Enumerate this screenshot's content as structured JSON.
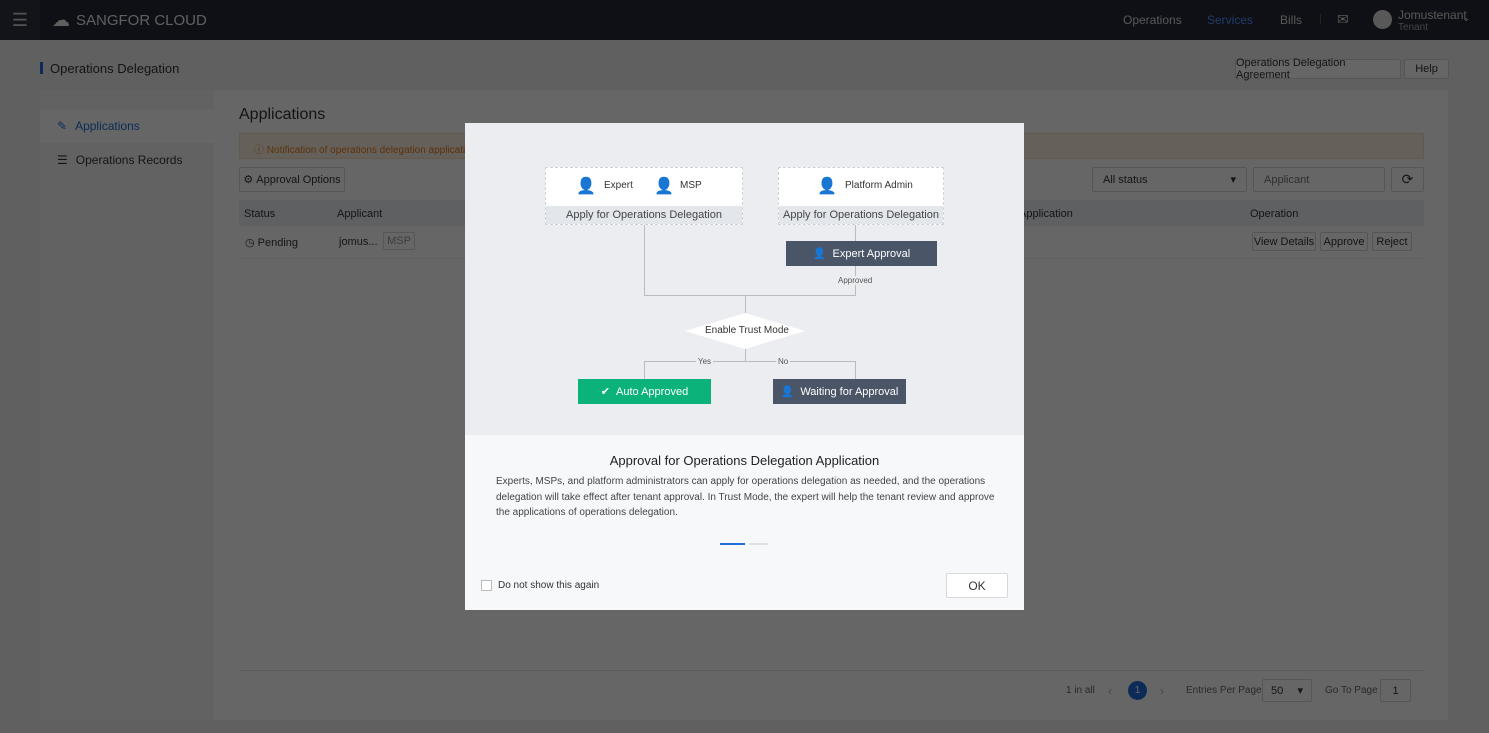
{
  "header": {
    "logo": "SANGFOR CLOUD",
    "nav": [
      "Operations",
      "Services",
      "Bills"
    ],
    "active_nav": "Services",
    "user": "Jomustenant",
    "role": "Tenant"
  },
  "page": {
    "title": "Operations Delegation",
    "agreement_btn": "Operations Delegation Agreement",
    "help_btn": "Help"
  },
  "sidebar": {
    "items": [
      {
        "label": "Applications",
        "active": true
      },
      {
        "label": "Operations Records"
      }
    ]
  },
  "main": {
    "title": "Applications",
    "notice": "Notification of operations delegation applications",
    "approval_options": "Approval Options",
    "status_filter": "All status",
    "search_placeholder": "Applicant",
    "columns": [
      "Status",
      "Applicant",
      "Application",
      "Operation"
    ],
    "rows": [
      {
        "status": "Pending",
        "applicant": "jomus...",
        "tag": "MSP",
        "actions": [
          "View Details",
          "Approve",
          "Reject"
        ]
      }
    ],
    "pagination": {
      "total": "1 in all",
      "page": "1",
      "entries_label": "Entries Per Page",
      "entries": "50",
      "goto_label": "Go To Page",
      "goto": "1"
    }
  },
  "modal": {
    "diagram": {
      "expert": "Expert",
      "msp": "MSP",
      "platform_admin": "Platform Admin",
      "apply": "Apply for Operations Delegation",
      "expert_approval": "Expert Approval",
      "approved": "Approved",
      "trust_mode": "Enable Trust Mode",
      "yes": "Yes",
      "no": "No",
      "auto_approved": "Auto Approved",
      "waiting": "Waiting for Approval"
    },
    "title": "Approval for Operations Delegation Application",
    "description": "Experts, MSPs, and platform administrators can apply for operations delegation as needed, and the operations delegation will take effect after tenant approval. In Trust Mode, the expert will help the tenant review and approve the applications of operations delegation.",
    "carousel": {
      "current": 1,
      "total": 2
    },
    "dont_show": "Do not show this again",
    "ok": "OK"
  },
  "colors": {
    "accent": "#1e6fd9",
    "green": "#0bb27a",
    "dark": "#4a5568"
  }
}
